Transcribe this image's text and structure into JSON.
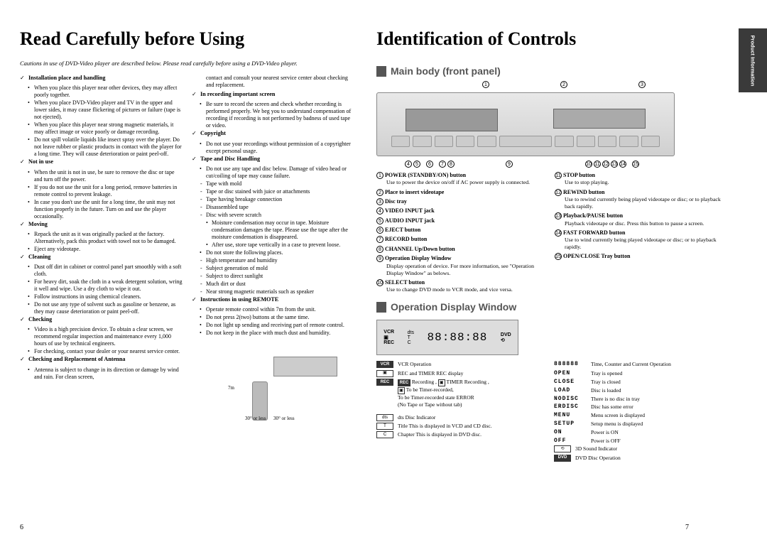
{
  "left": {
    "title": "Read Carefully before Using",
    "intro": "Cautions in use of DVD-Video player are described below. Please read carefully before using a DVD-Video player.",
    "col1": {
      "s1": {
        "h": "Installation place and handling",
        "p1": "When you place this player near other devices, they may affect poorly together.",
        "p2": "When you place DVD-Video player and TV in the upper and lower sides, it may cause flickering of pictures or failure (tape is not ejected).",
        "p3": "When you place this player near strong magnetic materials, it may affect image or voice poorly or damage recording.",
        "p4": "Do not spill volatile liquids like insect spray over the player. Do not leave rubber or plastic products in contact with the player for a long time. They will cause deterioration or paint peel-off."
      },
      "s2": {
        "h": "Not in use",
        "p1": "When the unit is not in use, be sure to remove the disc or tape and turn off the power.",
        "p2": "If you do not use the unit for a long period, remove batteries in remote control to prevent leakage.",
        "p3": "In case you don't use the unit for a long time, the unit may not function properly in the future. Turn on and use the player occasionally."
      },
      "s3": {
        "h": "Moving",
        "p1": "Repack the unit as it was originally packed at the factory. Alternatively, pack this product with towel not to be damaged.",
        "p2": "Eject any videotape."
      },
      "s4": {
        "h": "Cleaning",
        "p1": "Dust off dirt in cabinet or control panel part smoothly with a soft cloth.",
        "p2": "For heavy dirt, soak the cloth in a weak detergent solution, wring it well and wipe. Use a dry cloth to wipe it out.",
        "p3": "Follow instructions in using chemical cleaners.",
        "p4": "Do not use any type of solvent such as gasoline or benzene, as they may cause deterioration or paint peel-off."
      },
      "s5": {
        "h": "Checking",
        "p1": "Video is a high precision device. To obtain a clear screen, we recommend regular inspection and maintenance every 1,000 hours of use by technical engineers.",
        "p2": "For checking, contact your dealer or your nearest service center."
      },
      "s6": {
        "h": "Checking and Replacement of Antenna",
        "p1": "Antenna is subject to change in its direction or damage by wind and rain. For clean screen,"
      }
    },
    "col2": {
      "lead": "contact and consult your nearest service center about checking and replacement.",
      "s1": {
        "h": "In recording important screen",
        "p1": "Be sure to record the screen and check whether recording is performed properly. We beg you to understand compensation of recording if recording is not performed by badness of used tape or video."
      },
      "s2": {
        "h": "Copyright",
        "p1": "Do not use your recordings without permission of a copyrighter except personal usage."
      },
      "s3": {
        "h": "Tape and Disc Handling",
        "p1": "Do not use any tape and disc below. Damage of video head or cut/coiling of tape may cause failure.",
        "d1": "Tape with mold",
        "d2": "Tape or disc stained with juice or attachments",
        "d3": "Tape having breakage connection",
        "d4": "Disassembled tape",
        "d5": "Disc with severe scratch",
        "p2": "Moisture condensation may occur in tape. Moisture condensation damages the tape. Please use the tape after the moisture condensation is disappeared.",
        "p3": "After use, store tape vertically in a case to prevent loose.",
        "p4": "Do not store the following places.",
        "d6": "High temperature and humidity",
        "d7": "Subject generation of mold",
        "d8": "Subject to direct sunlight",
        "d9": "Much dirt or dust",
        "d10": "Near strong magnetic materials such as speaker"
      },
      "s4": {
        "h": "Instructions in using REMOTE",
        "p1": "Operate remote control within 7m from the unit.",
        "p2": "Do not press 2(two) buttons at the same time.",
        "p3": "Do not light up sending and receiving part of remote control.",
        "p4": "Do not keep in the place with much dust and humidity."
      },
      "remote": {
        "dist": "7m",
        "ang1": "30° or less",
        "ang2": "30° or less"
      }
    },
    "pagenum": "6"
  },
  "right": {
    "title": "Identification of Controls",
    "sidetab": "Product Information",
    "hdr1": "Main body (front panel)",
    "hdr2": "Operation Display Window",
    "controls": {
      "c1": {
        "t": "POWER (STANDBY/ON) button",
        "d": "Use to power the device on/off if AC power supply is connected."
      },
      "c2": {
        "t": "Place to insert videotape"
      },
      "c3": {
        "t": "Disc tray"
      },
      "c4": {
        "t": "VIDEO INPUT jack"
      },
      "c5": {
        "t": "AUDIO INPUT jack"
      },
      "c6": {
        "t": "EJECT button"
      },
      "c7": {
        "t": "RECORD button"
      },
      "c8": {
        "t": "CHANNEL Up/Down button"
      },
      "c9": {
        "t": "Operation Display Window",
        "d": "Display operation of device. For more information, see \"Operation Display Window\" as belows."
      },
      "c10": {
        "t": "SELECT button",
        "d": "Use to change DVD mode to VCR mode, and vice versa."
      },
      "c11": {
        "t": "STOP button",
        "d": "Use to stop playing."
      },
      "c12": {
        "t": "REWIND button",
        "d": "Use to rewind currently being played videotape or disc; or to playback back rapidly."
      },
      "c13": {
        "t": "Playback/PAUSE button",
        "d": "Playback videotape or disc. Press this button to pause a screen."
      },
      "c14": {
        "t": "FAST FORWARD button",
        "d": "Use to wind currently being played videotape or disc; or to playback rapidly."
      },
      "c15": {
        "t": "OPEN/CLOSE Tray button"
      }
    },
    "disp": {
      "left": {
        "vcr": {
          "ic": "VCR",
          "t": "VCR Operation"
        },
        "rec": {
          "t": "REC and TIMER REC display"
        },
        "rec2": {
          "ic": "REC",
          "t1": "Recording ,",
          "t2": "TIMER Recording ,",
          "t3": "To be Timer-recorded,",
          "t4": "To be Timer-recorded state ERROR",
          "t5": "(No Tape or Tape without tab)"
        },
        "dts": {
          "ic": "dts",
          "t": "dts Disc Indicator"
        },
        "title": {
          "ic": "T",
          "t": "Title This is displayed in VCD and CD disc."
        },
        "chap": {
          "ic": "C",
          "t": "Chapter This is displayed in DVD disc."
        }
      },
      "right": {
        "time": {
          "t": "Time, Counter and Current Operation"
        },
        "rows": {
          "r1": {
            "s": "OPEN",
            "t": "Tray is opened"
          },
          "r2": {
            "s": "CLOSE",
            "t": "Tray is closed"
          },
          "r3": {
            "s": "LOAD",
            "t": "Disc is loaded"
          },
          "r4": {
            "s": "NODISC",
            "t": "There is no disc in tray"
          },
          "r5": {
            "s": "ERDISC",
            "t": "Disc has some error"
          },
          "r6": {
            "s": "MENU",
            "t": "Menu screen is displayed"
          },
          "r7": {
            "s": "SETUP",
            "t": "Setup menu is displayed"
          },
          "r8": {
            "s": "ON",
            "t": "Power is ON"
          },
          "r9": {
            "s": "OFF",
            "t": "Power is OFF"
          }
        },
        "snd": {
          "t": "3D Sound Indicator"
        },
        "dvd": {
          "ic": "DVD",
          "t": "DVD Disc Operation"
        }
      }
    },
    "pagenum": "7"
  }
}
